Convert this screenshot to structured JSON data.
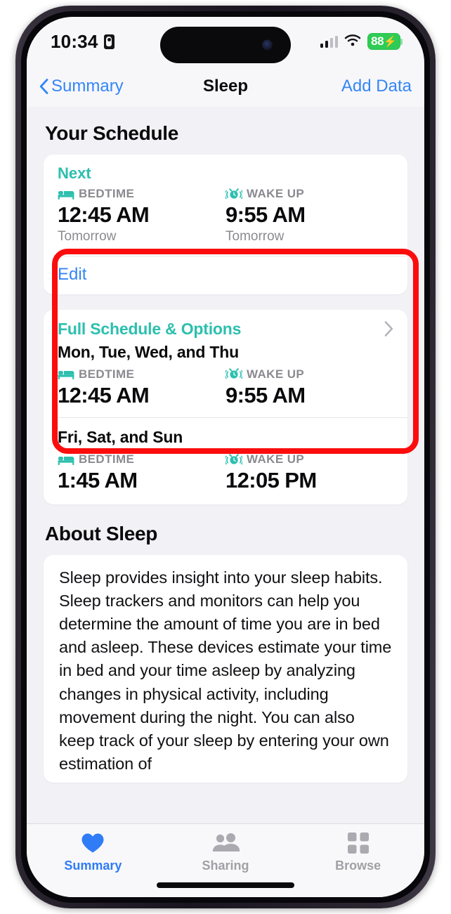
{
  "status_bar": {
    "time": "10:34",
    "recording_icon": "screen-record-icon",
    "signal_icon": "cellular-signal-icon",
    "wifi_icon": "wifi-icon",
    "battery_percent": "88",
    "battery_charging_icon": "charging-bolt-icon",
    "battery_color": "#2fcc55"
  },
  "nav": {
    "back_label": "Summary",
    "back_icon": "chevron-left-icon",
    "title": "Sleep",
    "action_label": "Add Data"
  },
  "colors": {
    "teal": "#2cbfae",
    "blue": "#3486f5",
    "annotation_red": "#fb0d0d",
    "gray_label": "#8a8a90",
    "page_bg": "#f1f1f6"
  },
  "your_schedule": {
    "section_title": "Your Schedule",
    "next_label": "Next",
    "bedtime": {
      "icon": "bed-icon",
      "label": "BEDTIME",
      "time": "12:45 AM",
      "sub": "Tomorrow"
    },
    "wakeup": {
      "icon": "alarm-clock-icon",
      "label": "WAKE UP",
      "time": "9:55 AM",
      "sub": "Tomorrow"
    },
    "edit_label": "Edit"
  },
  "full_schedule": {
    "title": "Full Schedule & Options",
    "chevron_icon": "chevron-right-icon",
    "highlighted": true,
    "rows": [
      {
        "days": "Mon, Tue, Wed, and Thu",
        "bedtime": {
          "icon": "bed-icon",
          "label": "BEDTIME",
          "time": "12:45 AM"
        },
        "wakeup": {
          "icon": "alarm-clock-icon",
          "label": "WAKE UP",
          "time": "9:55 AM"
        }
      },
      {
        "days": "Fri, Sat, and Sun",
        "bedtime": {
          "icon": "bed-icon",
          "label": "BEDTIME",
          "time": "1:45 AM"
        },
        "wakeup": {
          "icon": "alarm-clock-icon",
          "label": "WAKE UP",
          "time": "12:05 PM"
        }
      }
    ]
  },
  "about": {
    "section_title": "About Sleep",
    "body": "Sleep provides insight into your sleep habits. Sleep trackers and monitors can help you determine the amount of time you are in bed and asleep. These devices estimate your time in bed and your time asleep by analyzing changes in physical activity, including movement during the night. You can also keep track of your sleep by entering your own estimation of"
  },
  "tab_bar": {
    "tabs": [
      {
        "label": "Summary",
        "icon": "heart-icon",
        "active": true
      },
      {
        "label": "Sharing",
        "icon": "people-icon",
        "active": false
      },
      {
        "label": "Browse",
        "icon": "grid-icon",
        "active": false
      }
    ]
  }
}
